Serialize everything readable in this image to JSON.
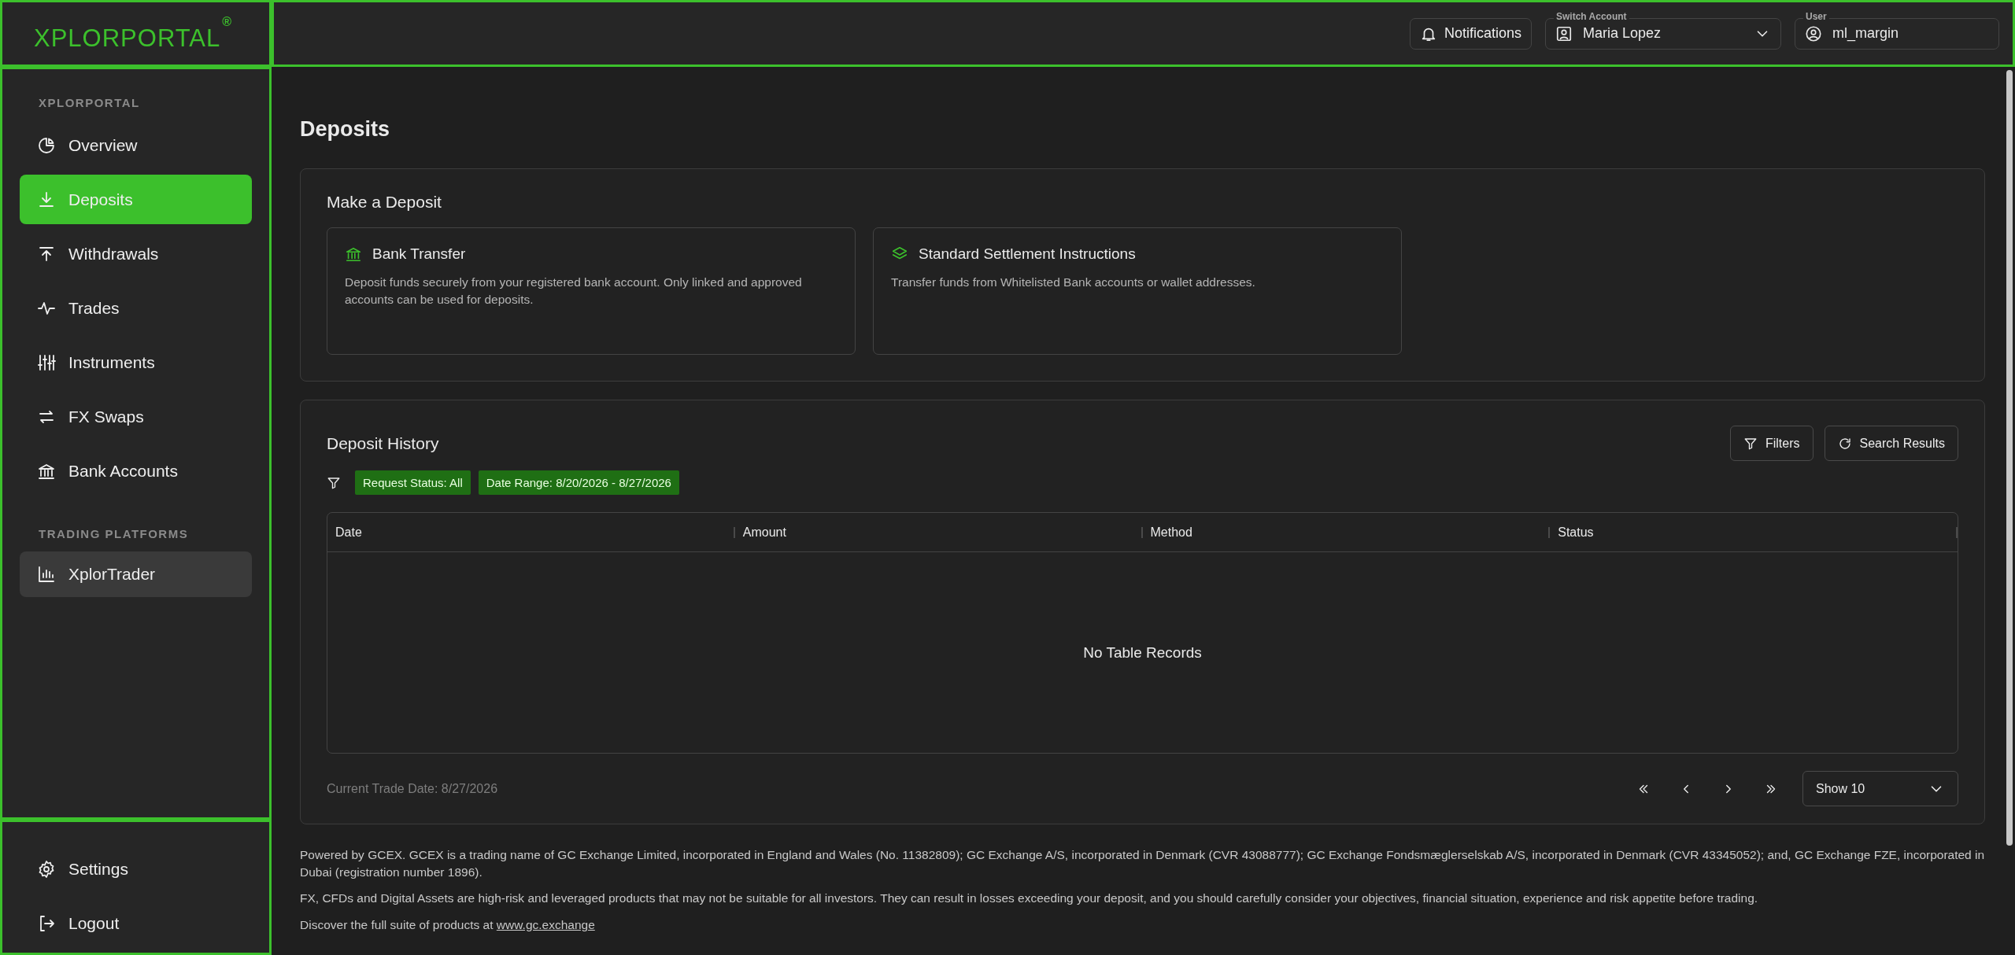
{
  "brand": {
    "name": "XPLORPORTAL",
    "mark": "®"
  },
  "header": {
    "notifications": "Notifications",
    "switch_account": {
      "label": "Switch Account",
      "value": "Maria Lopez"
    },
    "user": {
      "label": "User",
      "value": "ml_margin"
    }
  },
  "sidebar": {
    "sections": [
      {
        "kind": "navigation",
        "heading": "XPLORPORTAL",
        "items": [
          {
            "label": "Overview",
            "selected": false
          },
          {
            "label": "Deposits",
            "selected": true
          },
          {
            "label": "Withdrawals",
            "selected": false
          },
          {
            "label": "Trades",
            "selected": false
          },
          {
            "label": "Instruments",
            "selected": false
          },
          {
            "label": "FX Swaps",
            "selected": false
          },
          {
            "label": "Bank Accounts",
            "selected": false
          }
        ]
      },
      {
        "kind": "platforms",
        "heading": "TRADING PLATFORMS",
        "items": [
          {
            "label": "XplorTrader",
            "selected": false
          }
        ]
      }
    ],
    "bottom_items": [
      {
        "label": "Settings"
      },
      {
        "label": "Logout"
      }
    ]
  },
  "page": {
    "title": "Deposits",
    "make_deposit": {
      "title": "Make a Deposit",
      "methods": [
        {
          "title": "Bank Transfer",
          "description": "Deposit funds securely from your registered bank account. Only linked and approved accounts can be used for deposits."
        },
        {
          "title": "Standard Settlement Instructions",
          "description": "Transfer funds from Whitelisted Bank accounts or wallet addresses."
        }
      ]
    },
    "history": {
      "title": "Deposit History",
      "buttons": [
        "Filters",
        "Search Results"
      ],
      "filter_chips": [
        "Request Status: All",
        "Date Range: 8/20/2026 - 8/27/2026"
      ],
      "table": {
        "columns": [
          "Date",
          "Amount",
          "Method",
          "Status"
        ],
        "empty_text": "No Table Records"
      },
      "trade_date": "Current Trade Date: 8/27/2026",
      "page_size": "Show 10"
    }
  },
  "footer": {
    "paragraphs": [
      "Powered by GCEX. GCEX is a trading name of GC Exchange Limited, incorporated in England and Wales (No. 11382809); GC Exchange A/S, incorporated in Denmark (CVR 43088777); GC Exchange Fondsmæglerselskab A/S, incorporated in Denmark (CVR 43345052); and, GC Exchange FZE, incorporated in Dubai (registration number 1896).",
      "FX, CFDs and Digital Assets are high-risk and leveraged products that may not be suitable for all investors. They can result in losses exceeding your deposit, and you should carefully consider your objectives, financial situation, experience and risk appetite before trading."
    ],
    "discover": {
      "text": "Discover the full suite of products at",
      "link": "www.gc.exchange"
    }
  }
}
